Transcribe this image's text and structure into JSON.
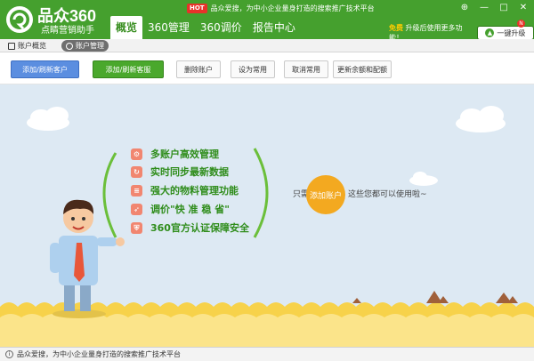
{
  "app": {
    "brand": "品众360",
    "subbrand": "点睛营销助手",
    "hot_badge": "HOT",
    "notice": "品众爱搜，为中小企业量身打造的搜索推广技术平台",
    "main_tabs": [
      {
        "label": "概览",
        "active": true
      },
      {
        "label": "360管理",
        "active": false
      },
      {
        "label": "360调价",
        "active": false
      },
      {
        "label": "报告中心",
        "active": false
      }
    ],
    "upgrade": {
      "free": "免费",
      "text": "升级后使用更多功能！",
      "button": "一键升级",
      "badge": "N"
    },
    "window_controls": {
      "skin": "⊕",
      "minimize": "—",
      "maximize": "□",
      "close": "✕"
    }
  },
  "subnav": {
    "overview": "账户概览",
    "account_manage": "账户管理"
  },
  "toolbar": {
    "add_customer": "添加/刷新客户",
    "add_team": "添加/刷新客服",
    "delete": "删除账户",
    "set_common": "设为常用",
    "cancel_common": "取消常用",
    "refresh_balance": "更新余额和配额"
  },
  "scene": {
    "features": [
      {
        "icon": "gears-icon",
        "text": "多账户高效管理"
      },
      {
        "icon": "sync-icon",
        "text": "实时同步最新数据"
      },
      {
        "icon": "layers-icon",
        "text": "强大的物料管理功能"
      },
      {
        "icon": "rocket-icon",
        "text": "调价\"快 准 稳 省\""
      },
      {
        "icon": "shield-icon",
        "text": "360官方认证保障安全"
      }
    ],
    "only_need": "只需",
    "add_account": "添加账户",
    "rest": "这些您都可以使用啦~"
  },
  "statusbar": {
    "text": "品众爱搜，为中小企业量身打造的搜索推广技术平台"
  },
  "colors": {
    "brand_green": "#45a02e",
    "scene_bg": "#dde9f3",
    "sand": "#f7d24a",
    "orange": "#f3a920",
    "feature_green": "#2f8d1b"
  }
}
